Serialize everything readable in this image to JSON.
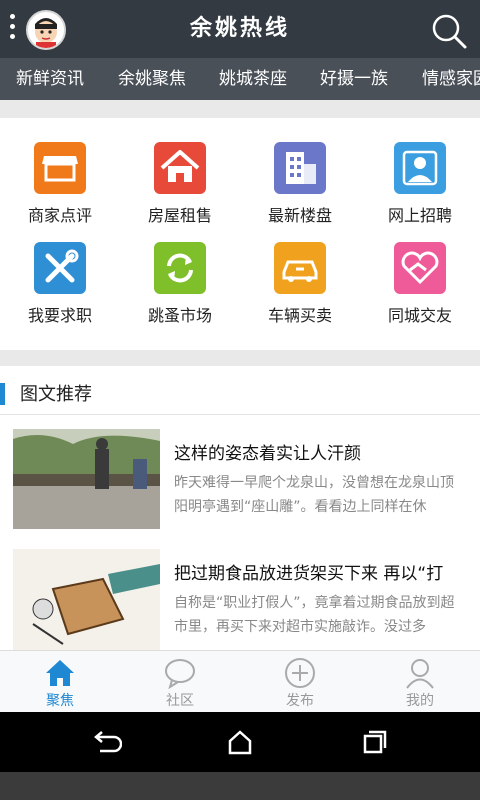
{
  "header": {
    "title": "余姚热线"
  },
  "tabs": [
    "新鲜资讯",
    "余姚聚焦",
    "姚城茶座",
    "好摄一族",
    "情感家园"
  ],
  "grid": [
    {
      "label": "商家点评",
      "icon": "shop-icon",
      "color": "#f07a1a"
    },
    {
      "label": "房屋租售",
      "icon": "house-icon",
      "color": "#e84a3a"
    },
    {
      "label": "最新楼盘",
      "icon": "building-icon",
      "color": "#6b77c9"
    },
    {
      "label": "网上招聘",
      "icon": "person-icon",
      "color": "#3b9ee0"
    },
    {
      "label": "我要求职",
      "icon": "tools-icon",
      "color": "#2f8fd4"
    },
    {
      "label": "跳蚤市场",
      "icon": "refresh-icon",
      "color": "#7fbf2a"
    },
    {
      "label": "车辆买卖",
      "icon": "car-icon",
      "color": "#f0a21e"
    },
    {
      "label": "同城交友",
      "icon": "handshake-icon",
      "color": "#ef5b98"
    }
  ],
  "section": {
    "title": "图文推荐"
  },
  "articles": [
    {
      "title": "这样的姿态着实让人汗颜",
      "desc": "昨天难得一早爬个龙泉山，没曾想在龙泉山顶阳明亭遇到“座山雕”。看看边上同样在休"
    },
    {
      "title": "把过期食品放进货架买下来 再以“打",
      "desc": "自称是“职业打假人”，竟拿着过期食品放到超市里，再买下来对超市实施敲诈。没过多"
    }
  ],
  "nav": [
    {
      "label": "聚焦",
      "icon": "home-icon"
    },
    {
      "label": "社区",
      "icon": "chat-bubble-icon"
    },
    {
      "label": "发布",
      "icon": "plus-circle-icon"
    },
    {
      "label": "我的",
      "icon": "user-icon"
    }
  ],
  "colors": {
    "accent": "#1e88d2",
    "topbar": "#333a41",
    "tabbar": "#4a5058"
  }
}
